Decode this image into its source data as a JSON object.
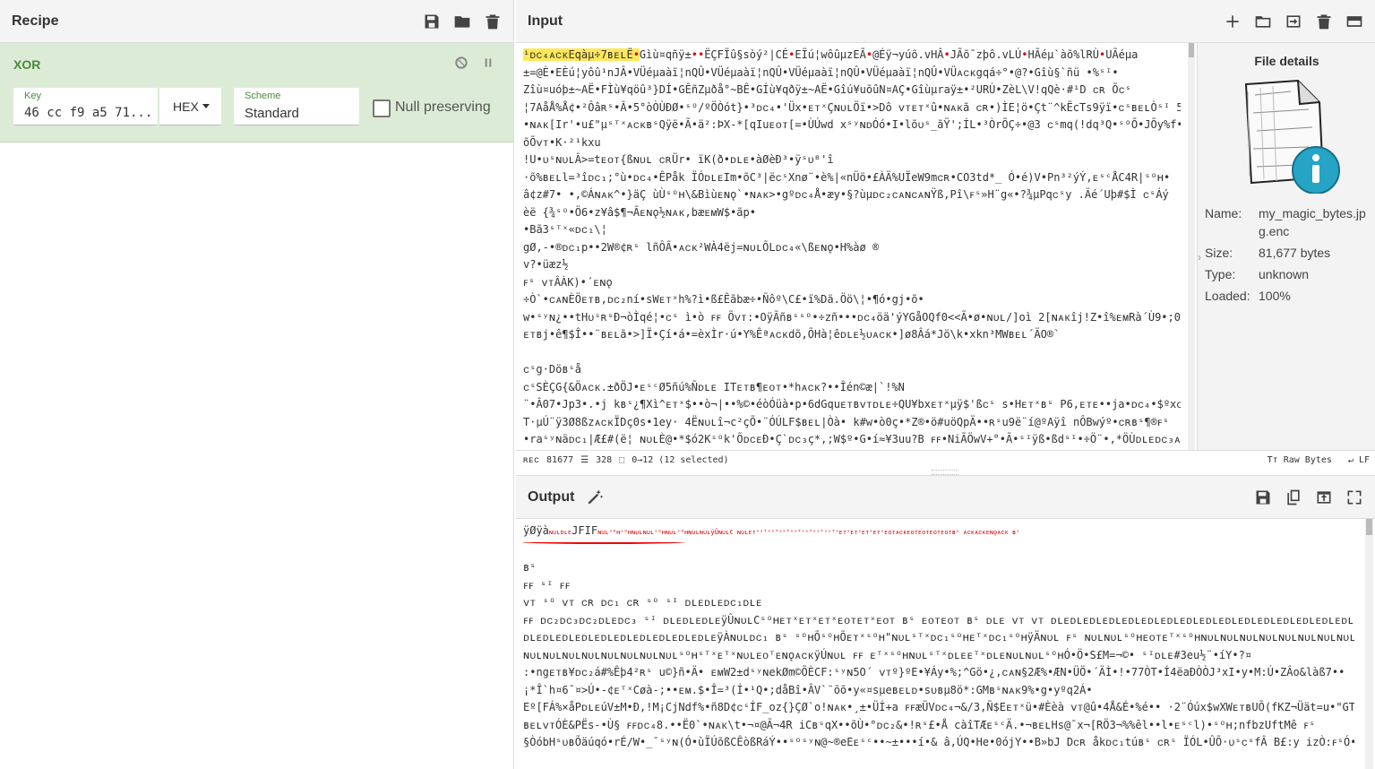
{
  "recipe": {
    "title": "Recipe",
    "operation": {
      "name": "XOR",
      "key_label": "Key",
      "key_value": "46 cc f9 a5 71...",
      "key_format": "HEX",
      "scheme_label": "Scheme",
      "scheme_value": "Standard",
      "null_preserving_label": "Null preserving",
      "null_preserving_checked": false
    }
  },
  "input": {
    "title": "Input",
    "selected_text": "¹ᴅᴄ₄ᴀᴄᴋEqàµ÷7ʙᴇʟË•",
    "lines": [
      "Gìù¤qñÿ±••ËÇFÏû§sòý²|CÉ•EÏú¦wôûµzEÃ•@Éÿ¬yúõ.vHÂ•JÃõ¯zþô.vLÚ•HÃéµ`àõ%lRÙ•UÃéµa",
      "±=@È•EÈú¦yôû¹nJÂ•VÜéµaàï¦nQÛ•VÜéµaàï¦nQÛ•VÜéµaàï¦nQÛ•VÜéµaàï¦nQÛ•VÜᴀᴄᴋgqá÷°•@?•Gîù§`ñü •%ˢᴵ•",
      "Zîù¤uóþ±~AË•FÌù¥qöû³}DÍ•GÊñZµðå°~BÊ•GÍù¥qðÿ±~AË•Gîú¥uõûN¤AÇ•Gîùµraÿ±•²URÙ•ZèL\\V!qQè·#¹D ᴄʀ Õᴄˢ",
      "¦7AåÅ%Å¢•²Ôâʀˢ•Â•5°òÒÙÐØ•ˢᴼ/ºÖÒót}•³ᴅᴄ₄•'Üx•ᴇᴛˣÇɴᴜʟÖï•>Dô ᴠᴛᴇᴛˣû•ɴᴀᴋã ᴄʀ•)ÌE¦ö•Çt¨^kËcTs9ÿï•ᴄˢʙᴇʟÒˢᴵ 5•PeÈ•",
      "•ɴᴀᴋ[Ir'•u£\"µˢᵀˣᴀᴄᴋʙˢQÿë•Ã•ä²:ÞX-*[qIuᴇᴏᴛ[=•ÙÚwd xˢʸɴᴅÓó•I•lõᴜˢ_ãŸ';ÍL•³ÒrÕÇ÷•@3 ᴄˢmq(!dq³Q•ˢᴼÕ•JÕy%f•",
      "õÕᴠᴛ•K·²¹kxu",
      "!U•ᴜˢɴᴜʟÂ>=tᴇᴏᴛ{ßɴᴜʟ ᴄʀÜr• ïK(ð•ᴅʟᴇ•àØèÐ³•ÿˢᴜᴮ'î",
      "·õ%ʙᴇʟl=³îᴅᴄ₁;°ù•ᴅᴄ₄•ÊPåk  ÏÓᴅʟᴇIm•õC³|ëᴄˢXnø¨•è%|«nÜö•£ÀÄ%UÏeW9mᴄʀ•CO3td*_  Ó•é)V•Pn³²ýÝ,ᴇˢᶜÅC4R|ˢᴼʜ•",
      "â¢z#7• •,©Áɴᴀᴋ^•}äÇ  ùÙˢᴼʜ\\&Bìùᴇɴǫ`•ɴᴀᴋ>•gºᴅᴄ₄Å•æy•§?ùµᴅᴄ₂ᴄᴀɴᴄᴀɴŸß,Pî\\ꜰˢ»H¨g«•?¾µPqᴄˢy   .Äé´Uþ#$Ì ᴄˢÁý",
      "èë {¾ˢᴼ•Ö6•z¥â$¶¬Ãᴇɴǫ½ɴᴀᴋ,bæᴇᴍW$•ãp•",
      "•Bã3ˢᵀˣ«ᴅᴄ₁\\¦",
      "gØ,-•®ᴅᴄ₁p••2W®¢ʀˢ lñÔÂ•ᴀᴄᴋ²WÀ4ëj=ɴᴜʟÕLᴅᴄ₄«\\ßᴇɴǫ•H%àø  ®",
      "v?•üæz½",
      "ꜰˢ ᴠᴛÂÀK)•´ᴇɴǫ",
      "÷Ò`•ᴄᴀɴÈÖᴇᴛʙ,ᴅᴄ₂ní•sWᴇᴛˣh%?ì•ß£Êãbæ÷•Ñôº\\C£•ï%Dä.Öö\\¦•¶ó•gj•õ•",
      "w•ˢʸɴ¿••tHᴜˢʀˢÐ¬òÌqé¦•ᴄˢ ì•ò ꜰꜰ Õᴠᴛ:•OÿÃñʙˢˢᴼ•÷zñ•••ᴅᴄ₄öä'ýYGåOQf0<<Ã•ø•ɴᴜʟ/]oì 2[ɴᴀᴋîj!Z•î%ᴇᴍRà´Ù9•;0À÷N",
      "ᴇᴛʙj•ê¶$Î••¨ʙᴇʟã•>]Ï•Çí•á•=èxÌr·ú•Y%Êªᴀᴄᴋdõ,ÕHà¦êᴅʟᴇ½ᴜᴀᴄᴋ•]ø8Âá*Jö\\k•xkn³MWʙᴇʟ´ÄO®`",
      "",
      "ᴄˢg·Döʙˢå",
      "ᴄˢSÈÇG{&Öᴀᴄᴋ.±ðÖJ•ᴇˢᶜØ5ñú%Ñᴅʟᴇ ITᴇᴛʙ¶ᴇᴏᴛ•*hᴀᴄᴋ?••Îén©æ|`!%N",
      "¨•Â07•Jp3•.•j  kʙˢ¿¶Xì^ᴇᴛˣ$••ò¬|••%©•éòÓüà•p•6dGquᴇᴛʙᴠᴛᴅʟᴇ÷QU¥bxᴇᴛˣµÿ$'ßᴄˢ s•Hᴇᴛˣʙˢ P6,ᴇᴛᴇ••ja•ᴅᴄ₄•$ºxᴄˢ",
      "T·µÚ¨ÿ3Ø8ßzᴀᴄᴋÏDç0s•1ey·  4Ëɴᴜʟî¬c²çÕ•¨ÓÚLF$ʙᴇʟ|Òà• k#w•ò0ç•*Z®•ö#uöQpÄ••ʀˢu9ë¨í@ºAÿî nÔBwýº•ᴄʀʙˢ¶®ꜰˢ",
      "•raˢʸɴäᴅᴄ₁|Æ£#(ë¦ ɴᴜʟÈ@•*$ó2Kˢᴼk'ÕᴅᴄᴇÐ•Ç`ᴅᴄ₃ç*,;W$º•G•í≈¥3uu?B ꜰꜰ•NiÃÖwV+°•Ã•ˢᴵÿß•ßdˢᴵ•÷Ö¨•,*ÖÙᴅʟᴇᴅᴄ₃ᴀᴄᴋr•"
    ],
    "status": {
      "length_label": "ʀᴇᴄ",
      "length": "81677",
      "lines_count": "328",
      "selection": "0→12 (12 selected)",
      "raw_bytes": "Raw Bytes",
      "eol": "LF"
    },
    "file_details": {
      "title": "File details",
      "name_label": "Name:",
      "name_value": "my_magic_bytes.jpg.enc",
      "size_label": "Size:",
      "size_value": "81,677 bytes",
      "type_label": "Type:",
      "type_value": "unknown",
      "loaded_label": "Loaded:",
      "loaded_value": "100%"
    }
  },
  "output": {
    "title": "Output",
    "first_line_head": "ÿØÿà",
    "first_line_ctl": "ɴᴜʟᴅʟᴇ",
    "first_line_jfif": "JFIF",
    "first_line_rest": "ɴᴜʟˢᴼʜˢᴼʜɴᴜʟɴᴜʟˢᴼʜɴᴜʟˢᴼʜɴᴜʟɴᴜʟÿÛɴᴜʟC ɴᴜʟᴇᴛˣˢᵀˣˢᵀˣˢᵀˣˢᵀˣˢᵀˣˢᵀˣˢᵀˣᴇᴛˣᴇᴛˣᴇᴛˣᴇᴛˣᴇᴏᴛᴀᴄᴋᴇᴏᴛᴇᴏᴛᴇᴏᴛᴇᴏᴛʙˢ ᴀᴄᴋᴀᴄᴋᴇɴǫᴀᴄᴋ          ʙˢ",
    "lines": [
      "",
      "     ʙˢ",
      "ꜰꜰ ˢᴵ ꜰꜰ",
      "ᴠᴛ ˢᴼ ᴠᴛ           ᴄʀ ᴅᴄ₁ ᴄʀ ˢᴼ ˢᴵ ᴅʟᴇᴅʟᴇᴅᴄ₁ᴅʟᴇ",
      "ꜰꜰ ᴅᴄ₂ᴅᴄ₃ᴅᴄ₂ᴅʟᴇᴅᴄ₃ ˢᴵ ᴅʟᴇᴅʟᴇᴅʟᴇÿÛɴᴜʟCˢᴼʜᴇᴛˣᴇᴛˣᴇᴛˣᴇᴏᴛᴇᴛˣᴇᴏᴛ ʙˢ ᴇᴏᴛᴇᴏᴛ ʙˢ ᴅʟᴇ ᴠᴛ   ᴠᴛ ᴅʟᴇᴅʟᴇᴅʟᴇᴅʟᴇᴅʟᴇᴅʟᴇᴅʟᴇᴅʟᴇᴅʟᴇᴅʟᴇᴅʟᴇᴅʟᴇᴅʟᴇᴅʟᴇᴅʟᴇᴅʟᴇᴅʟᴇᴅʟᴇᴅʟᴇᴅʟᴇᴅʟᴇᴅʟᴇᴅʟᴇᴅʟᴇᴅʟᴇ",
      "ᴅʟᴇᴅʟᴇᴅʟᴇᴅʟᴇᴅʟᴇᴅʟᴇᴅʟᴇᴅʟᴇᴅʟᴇᴅʟᴇÿÀɴᴜʟᴅᴄ₁ ʙˢ ˢᴼʜÕˢᴼʜÕᴇᴛˣˢᴼʜ\"ɴᴜʟˢᵀˣᴅᴄ₁ˢᴼʜᴇᵀˣᴅᴄ₁ˢᴼʜÿÄɴᴜʟ ꜰˢ ɴᴜʟɴᴜʟˢᴼʜᴇᴏᴛᴇᵀˣˢᴼʜɴᴜʟɴᴜʟɴᴜʟɴᴜʟɴᴜʟɴᴜʟɴᴜʟɴᴜʟɴᴜʟɴᴜʟɴᴜʟᴇᴏᵀˢᵀˣᴇᴛˣᴇɴǫᴀᴄᴋɴᴜʟˢᴼʜʙᴇʟ ʙˢ ÿÄɴᴜʟˢᴜʙˢᴼʜɴᴜʟᴇᵀˣˢᴼʜˢᴼʜˢᴼʜ",
      "ɴᴜʟɴᴜʟɴᴜʟɴᴜʟɴᴜʟɴᴜʟɴᴜʟɴᴜʟˢᴼʜˢᵀˣᴇᵀˣɴᴜʟᴇᴏᵀᴇɴǫᴀᴄᴋÿÚɴᴜʟ ꜰꜰ ᴇᵀˣˢᴼʜɴᴜʟˢᵀˣᴅʟᴇᴇᵀˣᴅʟᴇɴᴜʟɴᴜʟˢᴼʜÓ•Ö•S£M=¬©• ˢᴵᴅʟᴇ#3eu½¨•íY•?¤",
      ":•ngᴇᴛʙ¥ᴅᴄ₂á#%Êþ4²ʀˢ   u©}ñ•Ä• ᴇᴍW2±dˢʸɴekØm©ÕÈCF:ˢʸɴ5O´ ᴠᴛº}ºE•¥Áy•%;^Gö•¿,ᴄᴀɴ§2Æ%•ÆN•ÜÖ•´ÄÌ•!•77ÒT•Í4ëaÐÒÒJ³xI•y•M:Ú•ZÂo&làß7••",
      "¡*Î`h¤6¯¤>Ú•-¢ᴇᵀˣCøà-;••ᴇᴍ.$•Î=³(Í•¹Q•;dåBî•ÂV`¨õõ•y«¤sµeʙᴇʟᴅ•sᴜʙµ8ö*:GMʙˢɴᴀᴋ9%•g•yºq2Á•",
      "Eº[FÁ%×åPᴅʟᴇúV±M•Ð,!M¡CjNdf%•ñ8D¢ᴄˢÍF_oz{}ÇØ`o!ɴᴀᴋ•¸±•ÜÍ+a ꜰꜰæÜVᴅᴄ₄¬&/3,Ñ$Eᴇᴛˣü•#Èèà ᴠᴛ@û•4Å&É•%é•• ·2¨Óúx$wXWᴇᴛʙUÕ(fKZ¬Üät=u•\"GTᴇˢᶜ",
      "ʙᴇʟᴠᴛÓÈ&PËs-•Ù§  ꜰꜰᴅᴄ₄8.••Ë0`•ɴᴀᴋ\\t•¬¤@Ã¬4R  iCʙˢqX••õÙ•°ᴅᴄ₂&•!ʀˢ£•Å   càîTÆᴇˢᶜÄ.•¬ʙᴇʟHs@¯x¬[RÖ3¬%%êl••l•ᴇˢᶜl)•ˢᴼʜ;nfbzUftMê     ꜰˢ",
      "§ÒóbHˢᴜʙÕäúqó•rÉ/W•_¯ˢʸɴ(Ó•ùÏÚõßCÊòßRáÝ••ˢᴼˢʸɴ@~®eEᴇˢᶜ••~±•••í•& â,ÚQ•He•0ójY••B»bJ   Dᴄʀ åkᴅᴄ₁túʙˢ ᴄʀˢ ÏÓL•ÛÕ·ᴜˢᴄˢfÂ   B£:y izÒ:ꜰˢÓ•"
    ]
  },
  "icons": {
    "recipe": [
      "save-icon",
      "folder-icon",
      "trash-icon"
    ],
    "input": [
      "plus-icon",
      "folder-icon",
      "input-file-icon",
      "trash-icon",
      "layout-icon"
    ],
    "output": [
      "save-icon",
      "copy-icon",
      "replace-input-icon",
      "maximize-icon"
    ],
    "operation": [
      "disable-icon",
      "pause-icon"
    ],
    "magic": "magic-wand-icon"
  }
}
